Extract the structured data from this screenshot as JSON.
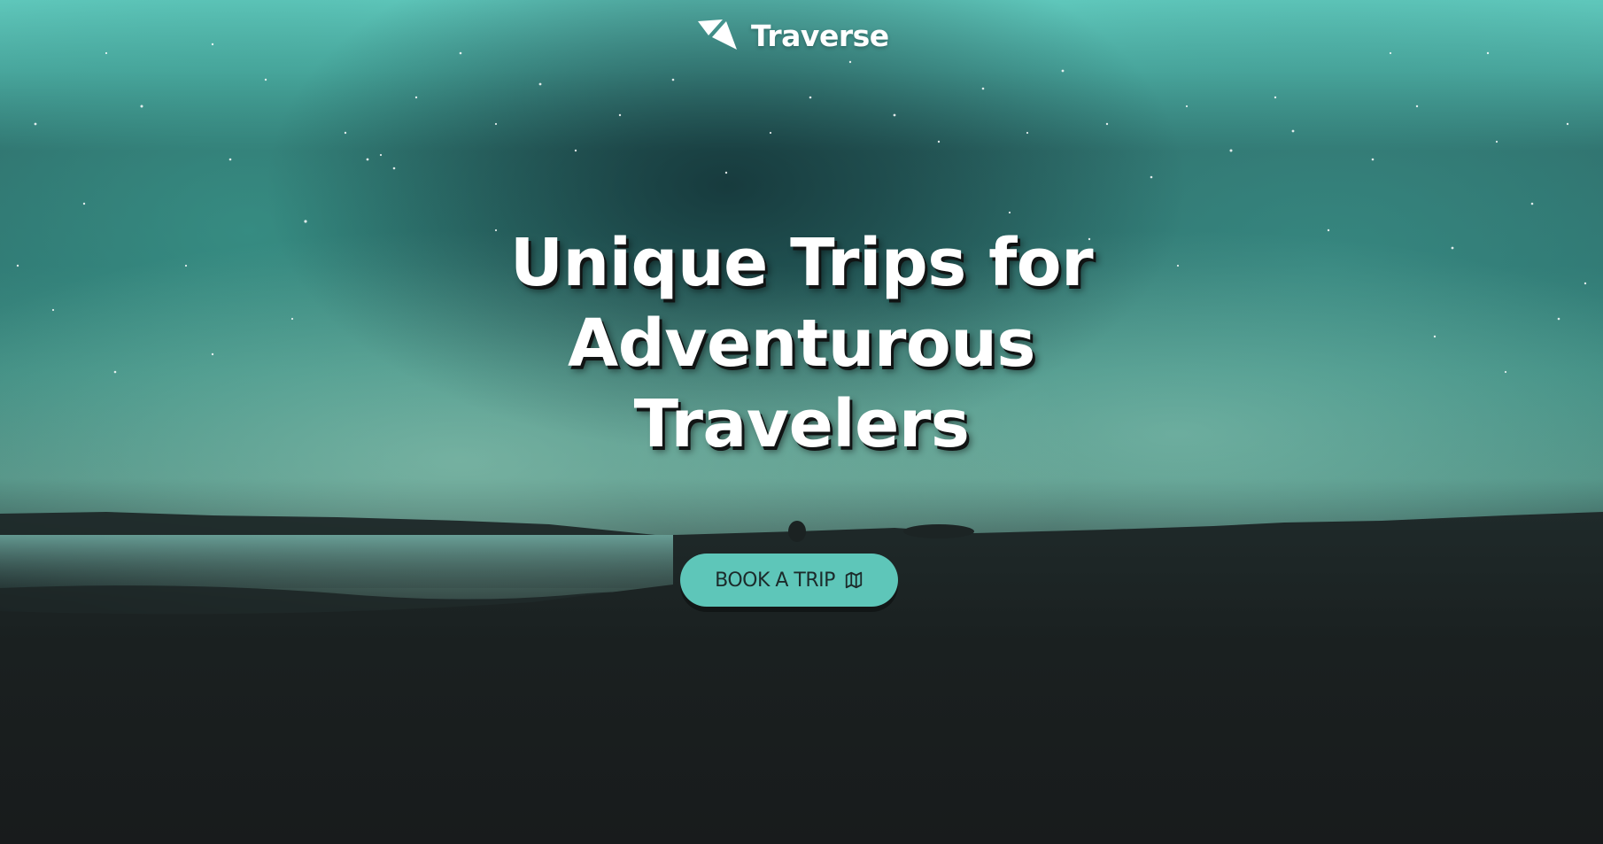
{
  "brand": {
    "name": "Traverse",
    "logo_icon": "triangle-logo-icon"
  },
  "hero": {
    "headline_lines": [
      "Unique Trips for",
      "Adventurous",
      "Travelers"
    ],
    "background": "northern-lights-night-sky-photo",
    "cta": {
      "label": "BOOK A TRIP",
      "icon": "map-icon"
    }
  },
  "colors": {
    "accent": "#5ec6b9",
    "headline": "#ffffff",
    "dark_ground": "#181b1c"
  }
}
